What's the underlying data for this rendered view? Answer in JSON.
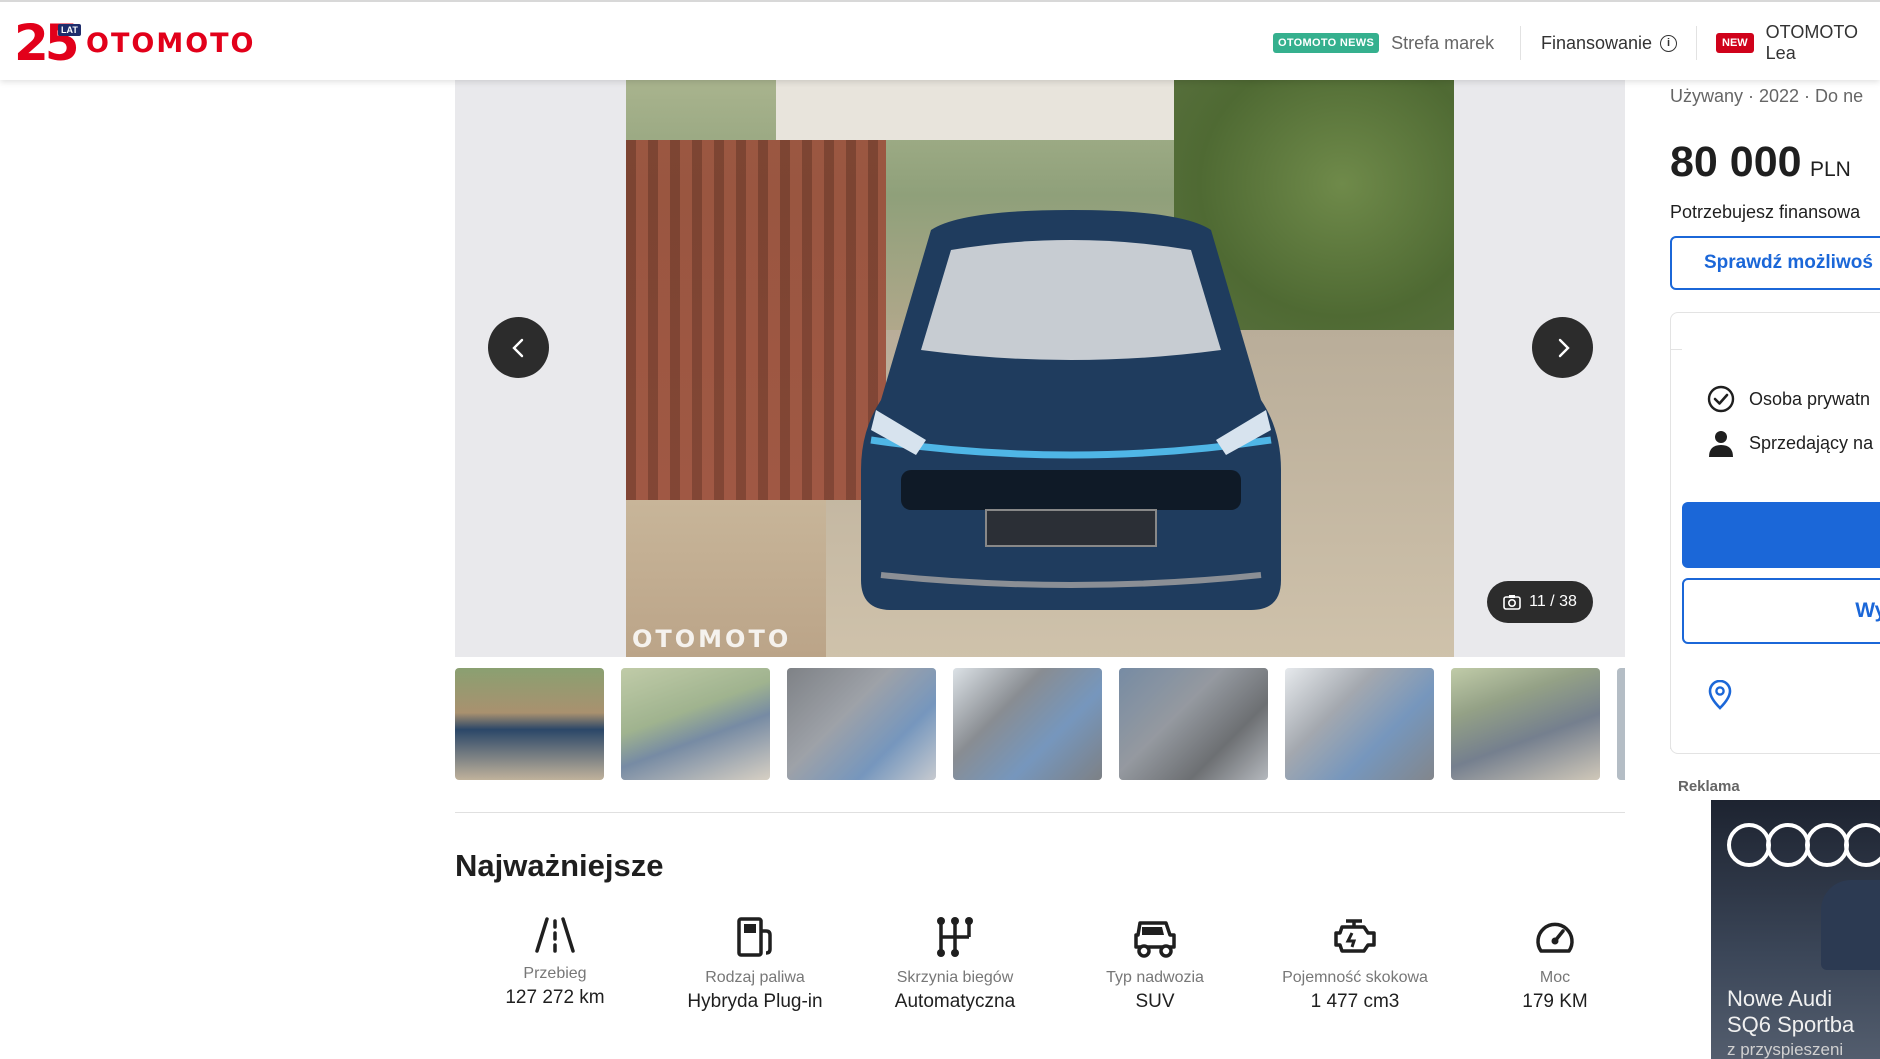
{
  "header": {
    "logo_number": "25",
    "logo_lat": "LAT",
    "logo_word": "OTOMOTO",
    "news_badge": "OTOMOTO NEWS",
    "brands_link": "Strefa marek",
    "financing_link": "Finansowanie",
    "new_badge": "NEW",
    "leasing_link": "OTOMOTO Lea"
  },
  "gallery": {
    "watermark": "OTOMOTO",
    "counter": "11 / 38",
    "thumbnails": 8
  },
  "highlights": {
    "title": "Najważniejsze",
    "items": [
      {
        "icon": "road-icon",
        "label": "Przebieg",
        "value": "127 272 km"
      },
      {
        "icon": "fuel-pump-icon",
        "label": "Rodzaj paliwa",
        "value": "Hybryda Plug-in"
      },
      {
        "icon": "gearbox-icon",
        "label": "Skrzynia biegów",
        "value": "Automatyczna"
      },
      {
        "icon": "car-body-icon",
        "label": "Typ nadwozia",
        "value": "SUV"
      },
      {
        "icon": "engine-icon",
        "label": "Pojemność skokowa",
        "value": "1 477 cm3"
      },
      {
        "icon": "speedometer-icon",
        "label": "Moc",
        "value": "179 KM"
      }
    ]
  },
  "listing": {
    "meta": "Używany · 2022 · Do ne",
    "price_amount": "80 000",
    "price_currency": "PLN",
    "financing_question": "Potrzebujesz finansowa",
    "check_button": "Sprawdź możliwoś"
  },
  "seller": {
    "type": "Osoba prywatn",
    "since": "Sprzedający na",
    "secondary_button": "Wyś"
  },
  "ad": {
    "label": "Reklama",
    "headline_1": "Nowe Audi",
    "headline_2": "SQ6 Sportba",
    "sub": "z przyspieszeni"
  }
}
